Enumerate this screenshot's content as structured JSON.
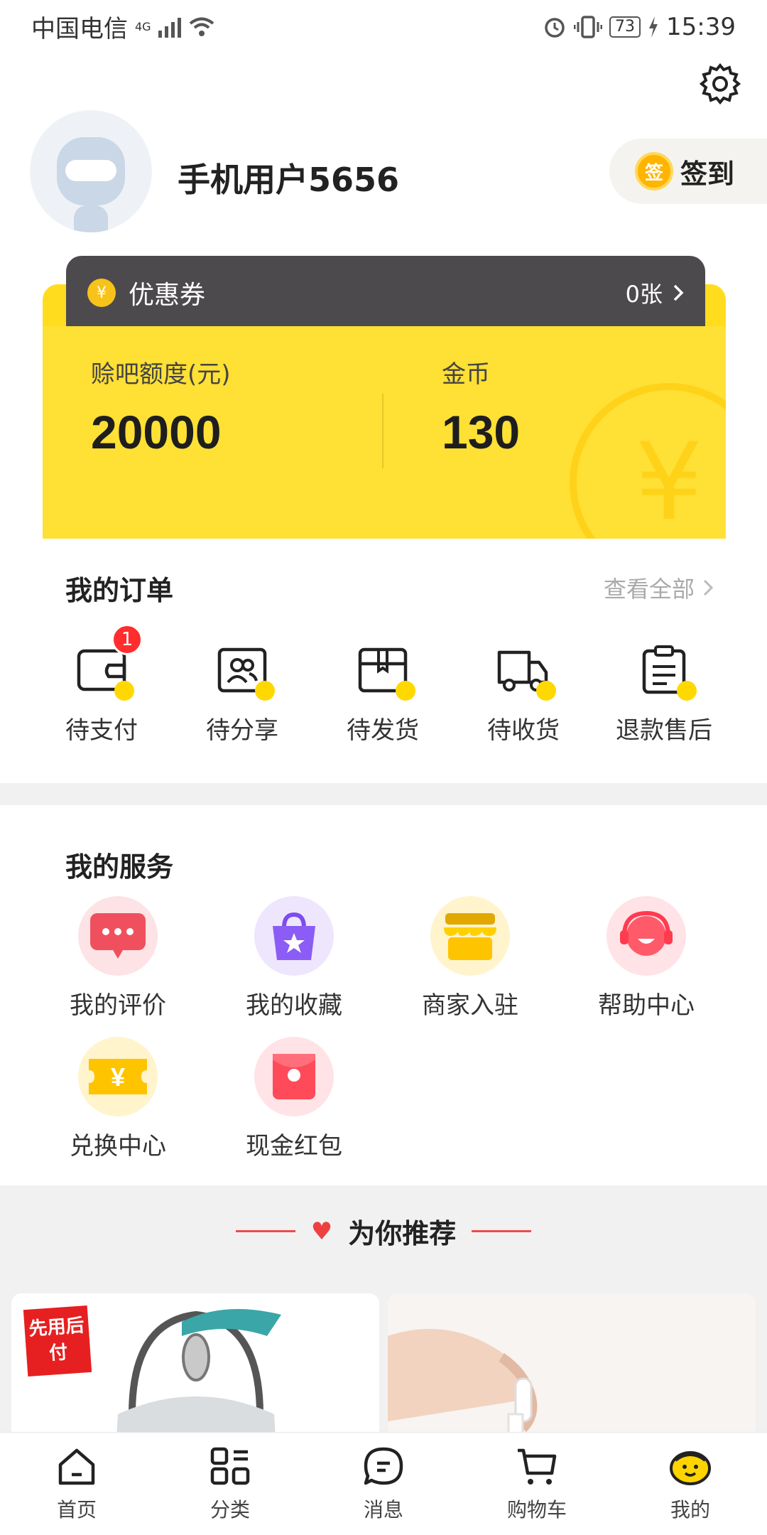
{
  "status_bar": {
    "carrier": "中国电信",
    "network": "4G",
    "battery": "73",
    "time": "15:39"
  },
  "profile": {
    "username": "手机用户5656",
    "sign_in_label": "签到",
    "sign_in_badge": "签"
  },
  "wallet": {
    "coupon_label": "优惠券",
    "coupon_count": "0张",
    "credit_label": "赊吧额度(元)",
    "credit_value": "20000",
    "coins_label": "金币",
    "coins_value": "130"
  },
  "orders": {
    "title": "我的订单",
    "view_all": "查看全部",
    "items": [
      {
        "label": "待支付",
        "badge": "1",
        "icon": "wallet-icon"
      },
      {
        "label": "待分享",
        "icon": "share-users-icon"
      },
      {
        "label": "待发货",
        "icon": "package-icon"
      },
      {
        "label": "待收货",
        "icon": "truck-icon"
      },
      {
        "label": "退款售后",
        "icon": "clipboard-icon"
      }
    ]
  },
  "services": {
    "title": "我的服务",
    "items": [
      {
        "label": "我的评价",
        "icon": "comment-icon",
        "color": "#f0505e"
      },
      {
        "label": "我的收藏",
        "icon": "favorite-bag-icon",
        "color": "#8b5cf6"
      },
      {
        "label": "商家入驻",
        "icon": "store-icon",
        "color": "#ffc400"
      },
      {
        "label": "帮助中心",
        "icon": "support-icon",
        "color": "#ff5a6a"
      },
      {
        "label": "兑换中心",
        "icon": "ticket-icon",
        "color": "#ffc400"
      },
      {
        "label": "现金红包",
        "icon": "red-packet-icon",
        "color": "#ff4a5a"
      }
    ]
  },
  "recommend": {
    "title": "为你推荐",
    "tag": "先用后付"
  },
  "nav": [
    {
      "label": "首页",
      "icon": "home-icon"
    },
    {
      "label": "分类",
      "icon": "category-icon"
    },
    {
      "label": "消息",
      "icon": "message-icon"
    },
    {
      "label": "购物车",
      "icon": "cart-icon"
    },
    {
      "label": "我的",
      "icon": "mine-face-icon"
    }
  ]
}
